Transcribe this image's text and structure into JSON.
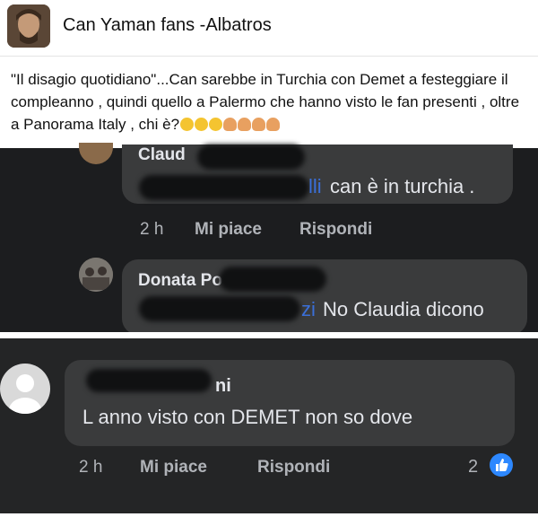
{
  "header": {
    "group_name": "Can Yaman fans -Albatros"
  },
  "post": {
    "text": "\"Il disagio quotidiano\"...Can sarebbe in Turchia con Demet a festeggiare il compleanno , quindi quello a Palermo che hanno visto le fan presenti , oltre a Panorama Italy , chi è?"
  },
  "comments": [
    {
      "name_partial": "Claud",
      "text_tail": "lli",
      "text": "can è in turchia .",
      "time": "2 h",
      "like_label": "Mi piace",
      "reply_label": "Rispondi"
    },
    {
      "name_partial": "Donata Po",
      "text_tail": "zi",
      "text": "No Claudia dicono"
    },
    {
      "name_partial": "ni",
      "text": "L anno visto con DEMET non so dove",
      "time": "2 h",
      "like_label": "Mi piace",
      "reply_label": "Rispondi",
      "reactions": "2"
    }
  ],
  "colors": {
    "dark_bg": "#1c1d1f",
    "bubble": "#3a3b3c",
    "text_light": "#e4e6eb",
    "meta_gray": "#b0b3b8",
    "like_blue": "#2d88ff"
  },
  "icons": [
    "group-avatar",
    "face-emoji",
    "woman-emoji",
    "like-reaction-icon",
    "default-avatar-icon"
  ]
}
